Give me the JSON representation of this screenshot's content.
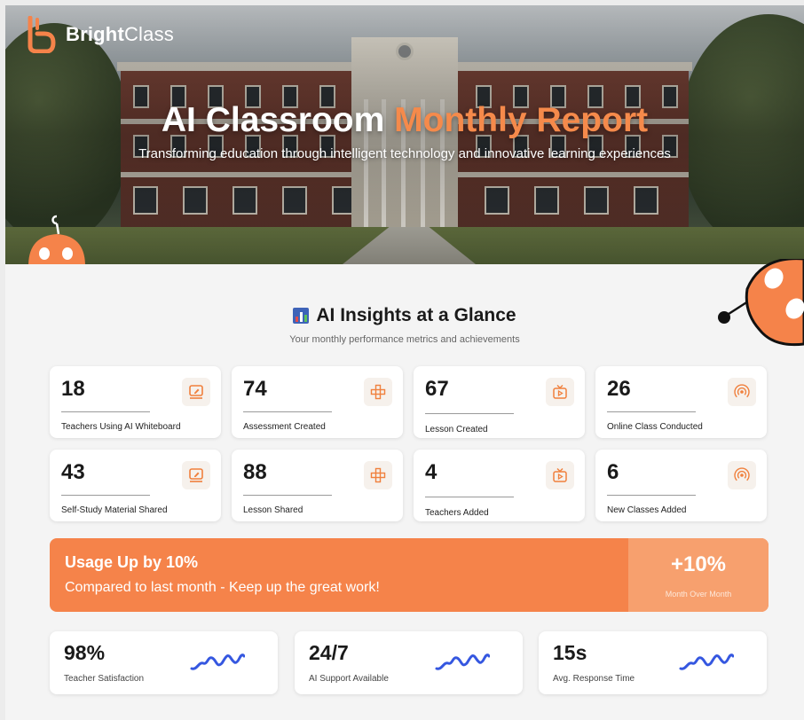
{
  "brand": {
    "name_bold": "Bright",
    "name_regular": "Class"
  },
  "hero": {
    "title_main": "AI Classroom",
    "title_accent": "Monthly Report",
    "subtitle": "Transforming education through intelligent technology and innovative learning experiences"
  },
  "insights": {
    "title": "AI Insights at a Glance",
    "subtitle": "Your monthly performance metrics and achievements",
    "cards": [
      {
        "value": "18",
        "label": "Teachers Using AI Whiteboard",
        "icon": "whiteboard-icon"
      },
      {
        "value": "74",
        "label": "Assessment Created",
        "icon": "assessment-icon"
      },
      {
        "value": "67",
        "label": "Lesson Created",
        "icon": "video-lesson-icon"
      },
      {
        "value": "26",
        "label": "Online Class Conducted",
        "icon": "broadcast-icon"
      },
      {
        "value": "43",
        "label": "Self-Study Material Shared",
        "icon": "whiteboard-icon"
      },
      {
        "value": "88",
        "label": "Lesson Shared",
        "icon": "assessment-icon"
      },
      {
        "value": "4",
        "label": "Teachers Added",
        "icon": "video-lesson-icon"
      },
      {
        "value": "6",
        "label": "New Classes Added",
        "icon": "broadcast-icon"
      }
    ]
  },
  "usage": {
    "headline": "Usage Up by 10%",
    "message": "Compared to last month - Keep up the great work!",
    "value": "+10%",
    "value_label": "Month Over Month"
  },
  "stats": [
    {
      "value": "98%",
      "label": "Teacher Satisfaction"
    },
    {
      "value": "24/7",
      "label": "AI Support Available"
    },
    {
      "value": "15s",
      "label": "Avg. Response Time"
    }
  ],
  "colors": {
    "accent": "#f58a4b",
    "banner": "#f5834a",
    "banner_right": "#f7a06e",
    "squiggle": "#3557e0"
  }
}
